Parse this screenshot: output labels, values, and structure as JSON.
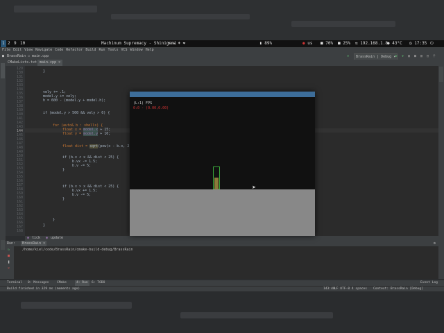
{
  "i3bar": {
    "workspaces": [
      "1",
      "2",
      "9",
      "10"
    ],
    "title": "Machinum Supremacy - Shinigami",
    "title_icons": "• ★ ♦ ❤",
    "battery": "89%",
    "network": "us",
    "cpu": "70%",
    "mem": "25%",
    "ip": "192.168.1.8",
    "temp": "43°C",
    "clock": "17:35"
  },
  "menubar": [
    "File",
    "Edit",
    "View",
    "Navigate",
    "Code",
    "Refactor",
    "Build",
    "Run",
    "Tools",
    "VCS",
    "Window",
    "Help"
  ],
  "navbar": {
    "project": "BrassRain",
    "file": "main.cpp",
    "run_config": "BrassRain | Debug"
  },
  "editor_tabs": [
    {
      "label": "CMakeLists.txt",
      "active": false
    },
    {
      "label": "main.cpp",
      "active": true
    }
  ],
  "gutter": [
    "129",
    "130",
    "131",
    "132",
    "133",
    "134",
    "135",
    "136",
    "137",
    "138",
    "139",
    "140",
    "141",
    "142",
    "143",
    "144",
    "145",
    "146",
    "147",
    "148",
    "149",
    "150",
    "151",
    "152",
    "153",
    "154",
    "155",
    "156",
    "157",
    "158",
    "159",
    "160",
    "161",
    "162",
    "163",
    "164",
    "165",
    "166",
    "167",
    "168"
  ],
  "code": {
    "l1": "}",
    "l2": "vely += .1;",
    "l3": "model.y += vely;",
    "l4": "h = 600 - (model.y + model.h);",
    "l5_a": "if (model.y > 500 && vely > 0) {",
    "l6": "for (auto& b : shells) {",
    "l7_a": "float x = ",
    "l7_b": "model.x",
    "l7_c": " + 15;",
    "l8_a": "float y = ",
    "l8_b": "model.y",
    "l8_c": " + 10;",
    "l9_a": "float dist = ",
    "l9_b": "sqrt",
    "l9_c": "(pow(x - b.x, 2) + pow(y - b.y, 2));",
    "l10": "if (b.x < x && dist < 25) {",
    "l11": "b.vx -= 1.5;",
    "l12": "b.v -= 5;",
    "l13": "}",
    "l14": "if (b.x > x && dist < 25) {",
    "l15": "b.vx += 1.5;",
    "l16": "b.v -= 5;",
    "l17": "}",
    "l18": "}",
    "l19": "}"
  },
  "breadcrumbs": [
    "tick",
    "update"
  ],
  "run": {
    "tab_label": "Run:",
    "config": "BrassRain",
    "path": "/home/kiel/code/BrassRain/cmake-build-debug/BrassRain"
  },
  "bottom_tabs": [
    "Terminal",
    "0: Messages",
    "CMake",
    "4: Run",
    "6: TODO"
  ],
  "event_log": "Event Log",
  "status": {
    "message": "Build finished in 329 ms (moments ago)",
    "position": "143:40",
    "encoding": "LF  UTF-8  4 spaces",
    "context": "Context: BrassRain [Debug]"
  },
  "game": {
    "fps": "(L:1) FPS",
    "debug": "0:0 - (0.00,0.00)"
  }
}
